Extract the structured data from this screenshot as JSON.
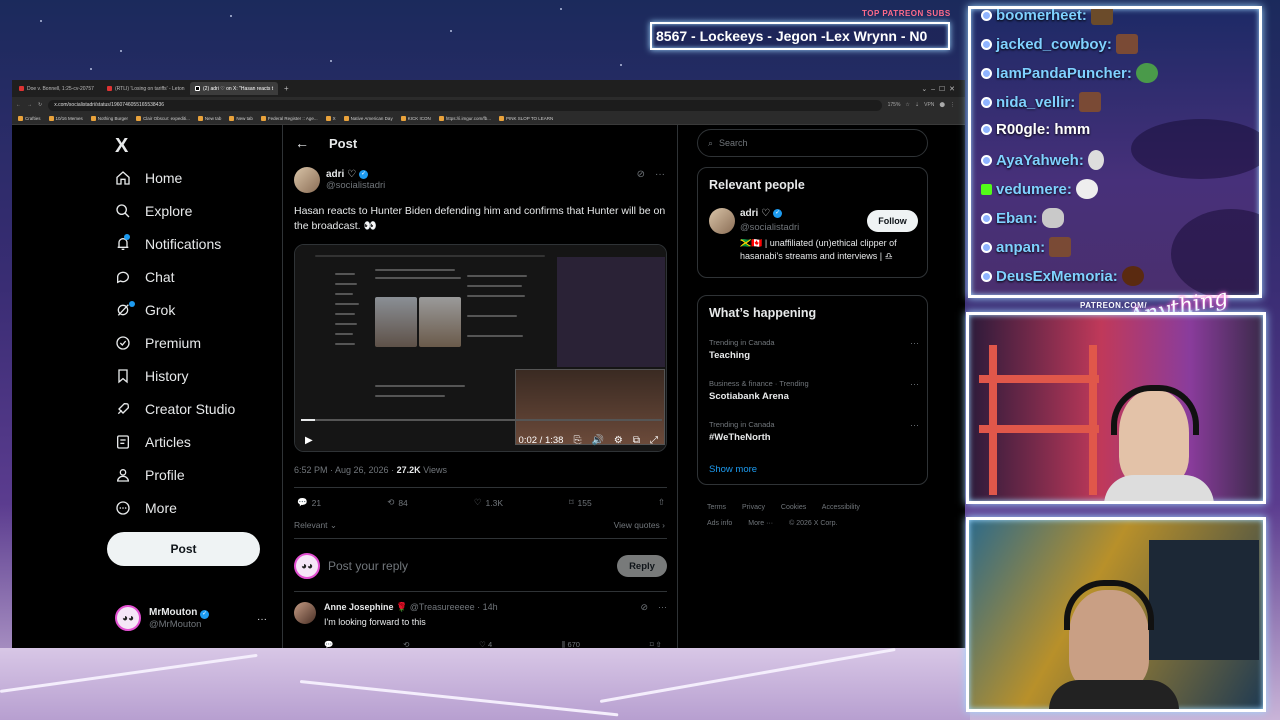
{
  "overlay": {
    "patreon_label": "TOP PATREON SUBS",
    "patreon_names": "8567 - Lockeeys - Jegon -Lex Wrynn -  N0",
    "patreon_url": "PATREON.COM/",
    "logo_script": "Anything else?"
  },
  "chat": [
    {
      "name": "boomerheet:",
      "emote": "beaver",
      "badge": "prime"
    },
    {
      "name": "jacked_cowboy:",
      "emote": "face",
      "badge": "prime"
    },
    {
      "name": "IamPandaPuncher:",
      "emote": "frog",
      "badge": "prime"
    },
    {
      "name": "nida_vellir:",
      "emote": "face",
      "badge": "prime"
    },
    {
      "name": "R00gle: hmm",
      "emote": "",
      "badge": "prime-sword"
    },
    {
      "name": "AyaYahweh:",
      "emote": "skull",
      "badge": "prime"
    },
    {
      "name": "vedumere:",
      "emote": "trollface",
      "badge": "kick"
    },
    {
      "name": "Eban:",
      "emote": "rocket",
      "badge": "prime"
    },
    {
      "name": "anpan:",
      "emote": "face",
      "badge": "prime"
    },
    {
      "name": "DeusExMemoria:",
      "emote": "donut",
      "badge": "prime"
    }
  ],
  "browser": {
    "tabs": [
      {
        "label": "Doe v. Bonnell, 1:25-cv-20757",
        "active": false
      },
      {
        "label": "(RTLI) 'Losing on tariffs' - Leton",
        "active": false
      },
      {
        "label": "(2) adri ♡ on X: \"Hasan reacts t",
        "active": true
      }
    ],
    "url": "x.com/socialistadri/status/1960746055165538436",
    "zoom": "175%",
    "vpn": "VPN",
    "bookmarks": [
      "Crafties",
      "10/16 Memes",
      "Nothing Burger",
      "Clair Obscur: expediti...",
      "New tab",
      "New tab",
      "Federal Register :: Age...",
      "X",
      "Native American Day",
      "KICK ICON",
      "https://i.imgur.com/fb...",
      "PINK SLOP TO LEARN"
    ]
  },
  "nav": {
    "logo": "X",
    "items": [
      {
        "label": "Home",
        "icon": "home-icon"
      },
      {
        "label": "Explore",
        "icon": "search-icon"
      },
      {
        "label": "Notifications",
        "icon": "bell-icon",
        "badge": "3"
      },
      {
        "label": "Chat",
        "icon": "chat-icon"
      },
      {
        "label": "Grok",
        "icon": "grok-icon"
      },
      {
        "label": "Premium",
        "icon": "premium-icon"
      },
      {
        "label": "History",
        "icon": "bookmark-icon"
      },
      {
        "label": "Creator Studio",
        "icon": "rocket-icon"
      },
      {
        "label": "Articles",
        "icon": "articles-icon"
      },
      {
        "label": "Profile",
        "icon": "person-icon"
      },
      {
        "label": "More",
        "icon": "more-icon"
      }
    ],
    "post_label": "Post",
    "account_name": "MrMouton",
    "account_handle": "@MrMouton"
  },
  "post": {
    "header": "Post",
    "author_name": "adri ♡",
    "author_handle": "@socialistadri",
    "text": "Hasan reacts to Hunter Biden defending him and confirms that Hunter will be on the broadcast. 👀",
    "video_time": "0:02 / 1:38",
    "video_progress": 0.04,
    "time": "6:52 PM · Aug 26, 2026 ·",
    "views_count": "27.2K",
    "views_label": "Views",
    "replies": "21",
    "reposts": "84",
    "likes": "1.3K",
    "bookmarks": "155",
    "sort_label": "Relevant",
    "view_quotes": "View quotes",
    "reply_placeholder": "Post your reply",
    "reply_button": "Reply"
  },
  "reply": {
    "name": "Anne Josephine",
    "emoji": "🌹",
    "handle": "@Treasureeeee",
    "age": "· 14h",
    "text": "I'm looking forward to this",
    "likes": "4",
    "views": "670"
  },
  "sidebar": {
    "search_placeholder": "Search",
    "relevant_title": "Relevant people",
    "person_name": "adri ♡",
    "person_handle": "@socialistadri",
    "follow_label": "Follow",
    "person_bio": "🇯🇲🇨🇦 | unaffiliated (un)ethical clipper of hasanabi's streams and interviews | ♎",
    "happening_title": "What’s happening",
    "trends": [
      {
        "context": "Trending in Canada",
        "name": "Teaching"
      },
      {
        "context": "Business & finance · Trending",
        "name": "Scotiabank Arena"
      },
      {
        "context": "Trending in Canada",
        "name": "#WeTheNorth"
      }
    ],
    "show_more": "Show more",
    "footer": [
      "Terms",
      "Privacy",
      "Cookies",
      "Accessibility",
      "Ads info",
      "More ···",
      "© 2026 X Corp."
    ]
  },
  "colors": {
    "accent": "#1d9bf0",
    "background": "#000000",
    "border": "#2f3336",
    "muted": "#71767b"
  }
}
